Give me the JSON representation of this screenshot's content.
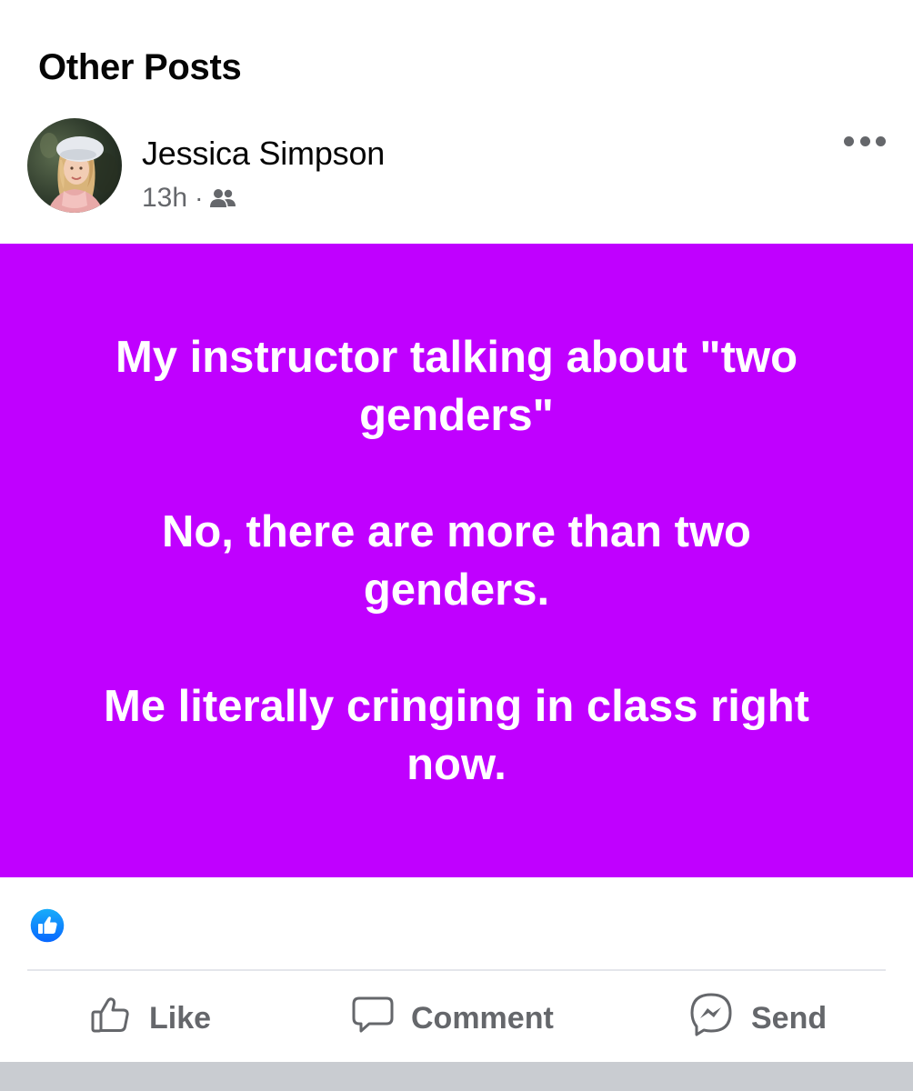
{
  "section": {
    "title": "Other Posts"
  },
  "post": {
    "author": "Jessica Simpson",
    "time": "13h",
    "separator": "·",
    "audience_icon": "friends-icon",
    "more_icon": "more-horizontal-icon",
    "background_color": "#c000ff",
    "paragraphs": [
      "My instructor talking about \"two genders\"",
      "No, there are more than two genders.",
      "Me literally cringing in class right now."
    ],
    "reactions": {
      "icon": "like-reaction-icon",
      "color": "#1877f2"
    }
  },
  "actions": {
    "like_label": "Like",
    "comment_label": "Comment",
    "send_label": "Send"
  }
}
